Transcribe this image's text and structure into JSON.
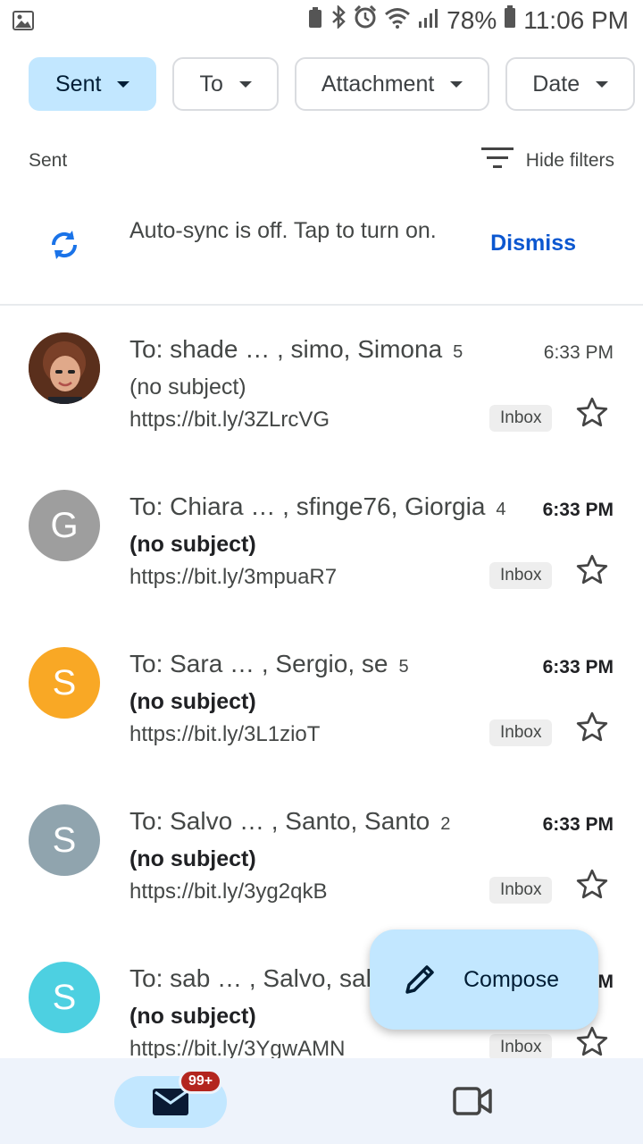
{
  "status_bar": {
    "battery": "78%",
    "time": "11:06 PM",
    "icons": [
      "gallery-icon",
      "recycle-icon",
      "bluetooth-icon",
      "alarm-icon",
      "wifi-icon",
      "signal-icon",
      "battery-icon"
    ]
  },
  "filters": {
    "chips": [
      {
        "label": "Sent",
        "active": true
      },
      {
        "label": "To",
        "active": false
      },
      {
        "label": "Attachment",
        "active": false
      },
      {
        "label": "Date",
        "active": false
      }
    ],
    "folder_label": "Sent",
    "hide_filters": "Hide filters"
  },
  "sync_banner": {
    "text": "Auto-sync is off. Tap to turn on.",
    "dismiss": "Dismiss"
  },
  "emails": [
    {
      "recipients": "To: shade … , simo, Simona",
      "count": "5",
      "time": "6:33 PM",
      "unread": false,
      "subject": "(no subject)",
      "snippet": "https://bit.ly/3ZLrcVG",
      "label": "Inbox",
      "avatar_letter": "",
      "avatar_color": "#6b3a24"
    },
    {
      "recipients": "To: Chiara … , sfinge76, Giorgia",
      "count": "4",
      "time": "6:33 PM",
      "unread": true,
      "subject": "(no subject)",
      "snippet": "https://bit.ly/3mpuaR7",
      "label": "Inbox",
      "avatar_letter": "G",
      "avatar_color": "#9e9e9e"
    },
    {
      "recipients": "To: Sara … , Sergio, se",
      "count": "5",
      "time": "6:33 PM",
      "unread": true,
      "subject": "(no subject)",
      "snippet": "https://bit.ly/3L1zioT",
      "label": "Inbox",
      "avatar_letter": "S",
      "avatar_color": "#f9a825"
    },
    {
      "recipients": "To: Salvo … , Santo, Santo",
      "count": "2",
      "time": "6:33 PM",
      "unread": true,
      "subject": "(no subject)",
      "snippet": "https://bit.ly/3yg2qkB",
      "label": "Inbox",
      "avatar_letter": "S",
      "avatar_color": "#90a4ae"
    },
    {
      "recipients": "To: sab … , Salvo, salv",
      "count": "",
      "time": "M",
      "unread": true,
      "subject": "(no subject)",
      "snippet": "https://bit.ly/3YgwAMN",
      "label": "Inbox",
      "avatar_letter": "S",
      "avatar_color": "#4dd0e1"
    }
  ],
  "compose": {
    "label": "Compose"
  },
  "bottom_nav": {
    "mail_badge": "99+"
  }
}
